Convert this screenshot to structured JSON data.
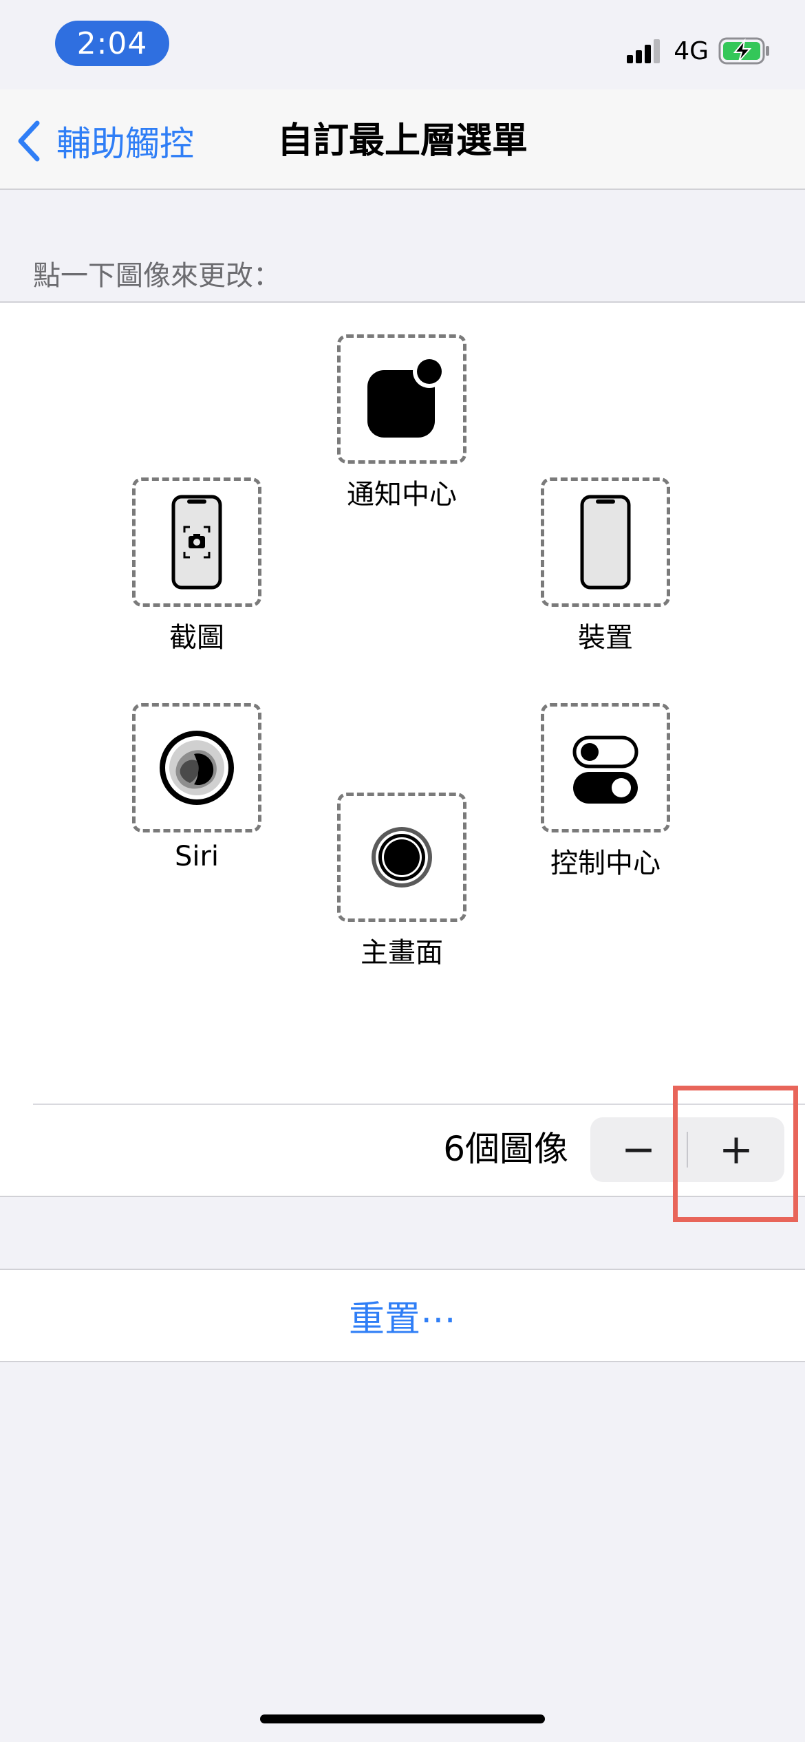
{
  "status_bar": {
    "time": "2:04",
    "network": "4G"
  },
  "nav": {
    "back_label": "輔助觸控",
    "title": "自訂最上層選單"
  },
  "section_header": "點一下圖像來更改：",
  "menu_slots": [
    {
      "label": "通知中心",
      "icon": "notification-center-icon"
    },
    {
      "label": "截圖",
      "icon": "screenshot-icon"
    },
    {
      "label": "裝置",
      "icon": "device-icon"
    },
    {
      "label": "Siri",
      "icon": "siri-icon"
    },
    {
      "label": "控制中心",
      "icon": "control-center-icon"
    },
    {
      "label": "主畫面",
      "icon": "home-icon"
    }
  ],
  "icon_count_label": "6個圖像",
  "stepper": {
    "minus": "−",
    "plus": "+"
  },
  "reset_label": "重置⋯",
  "colors": {
    "accent": "#2f7ef6",
    "time_pill": "#2f6fe0",
    "highlight": "#e8655a",
    "battery_charge": "#34c759"
  }
}
